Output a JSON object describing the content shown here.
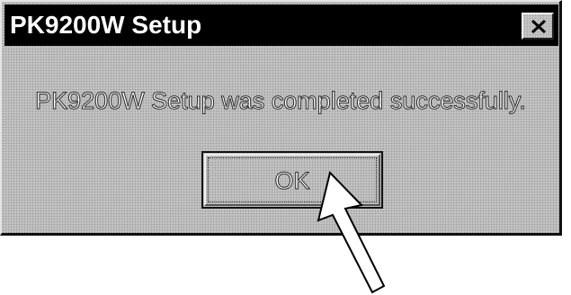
{
  "window": {
    "title": "PK9200W Setup",
    "close_icon": "close-x-icon"
  },
  "message": {
    "text": "PK9200W Setup was completed successfully."
  },
  "buttons": {
    "ok_label": "OK"
  },
  "pointer": {
    "icon": "arrow-pointer-icon"
  },
  "colors": {
    "titlebar_bg": "#000000",
    "title_text": "#ffffff",
    "dialog_face": "#c3c3c3"
  }
}
